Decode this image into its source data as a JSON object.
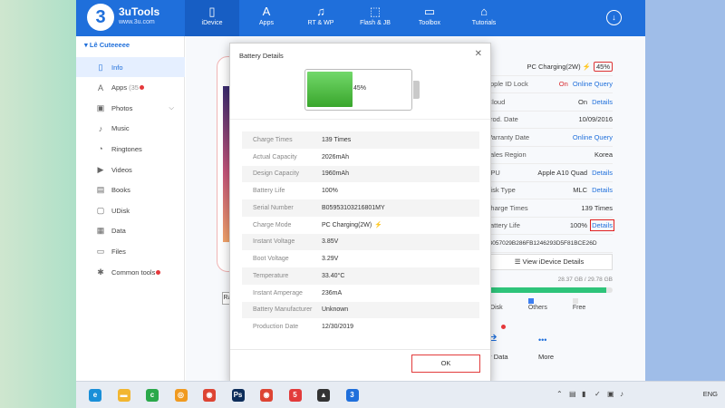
{
  "app": {
    "brand": "3uTools",
    "brand_logo": "3",
    "brand_url": "www.3u.com",
    "accent_color": "#1f6fdb",
    "nav": [
      {
        "label": "iDevice",
        "icon": "phone-icon",
        "glyph": "▯",
        "active": true
      },
      {
        "label": "Apps",
        "icon": "app-store-icon",
        "glyph": "A"
      },
      {
        "label": "RT & WP",
        "icon": "music-icon",
        "glyph": "♫"
      },
      {
        "label": "Flash & JB",
        "icon": "flash-icon",
        "glyph": "⬚"
      },
      {
        "label": "Toolbox",
        "icon": "toolbox-icon",
        "glyph": "▭"
      },
      {
        "label": "Tutorials",
        "icon": "graduation-cap-icon",
        "glyph": "⌂"
      }
    ],
    "download_glyph": "↓"
  },
  "sidebar": {
    "device_name": "Lê Cuteeeee",
    "chevron": "▾",
    "items": [
      {
        "label": "Info",
        "icon": "phone-icon",
        "glyph": "▯",
        "active": true
      },
      {
        "label": "Apps",
        "icon": "app-store-icon",
        "glyph": "A",
        "badge": "(35",
        "dot": true
      },
      {
        "label": "Photos",
        "icon": "photos-icon",
        "glyph": "▣",
        "chevron": "⌵"
      },
      {
        "label": "Music",
        "icon": "music-icon",
        "glyph": "♪"
      },
      {
        "label": "Ringtones",
        "icon": "bell-icon",
        "glyph": "◔"
      },
      {
        "label": "Videos",
        "icon": "video-icon",
        "glyph": "▶"
      },
      {
        "label": "Books",
        "icon": "book-icon",
        "glyph": "▤"
      },
      {
        "label": "UDisk",
        "icon": "usb-icon",
        "glyph": "▢"
      },
      {
        "label": "Data",
        "icon": "data-icon",
        "glyph": "▦"
      },
      {
        "label": "Files",
        "icon": "file-icon",
        "glyph": "▭"
      },
      {
        "label": "Common tools",
        "icon": "tools-icon",
        "glyph": "✱",
        "dot": true
      }
    ]
  },
  "device_info": {
    "charging": "PC Charging(2W)",
    "charging_pct": "45%",
    "bolt": "⚡",
    "rows": [
      {
        "label": "Apple ID Lock",
        "value": "On",
        "value_color": "#d8262b",
        "link": "Online Query"
      },
      {
        "label": "iCloud",
        "value": "On",
        "link": "Details"
      },
      {
        "label": "Prod. Date",
        "value": "10/09/2016"
      },
      {
        "label": "Warranty Date",
        "link": "Online Query"
      },
      {
        "label": "Sales Region",
        "value": "Korea"
      },
      {
        "label": "CPU",
        "value": "Apple A10 Quad",
        "link": "Details"
      },
      {
        "label": "Disk Type",
        "value": "MLC",
        "link": "Details"
      },
      {
        "label": "Charge Times",
        "value": "139 Times"
      },
      {
        "label": "Battery Life",
        "value": "100%",
        "link": "Details",
        "highlight": true
      }
    ],
    "udid": "73057029B286FB1246293D5F81BCE26D",
    "view_details": "View iDevice Details",
    "storage_text": "28.37 GB / 29.78 GB",
    "storage_used_fraction": 0.95,
    "legend": [
      {
        "label": "UDisk",
        "color": "#b486f0"
      },
      {
        "label": "Others",
        "color": "#3c7ef0"
      },
      {
        "label": "Free",
        "color": "#e4e4e4"
      }
    ],
    "ops": [
      {
        "label": "er Data",
        "icon": "transfer-data-icon",
        "glyph": "⇄",
        "dot": true
      },
      {
        "label": "More",
        "icon": "more-icon",
        "glyph": "•••"
      }
    ],
    "mini_button": "Ra"
  },
  "dialog": {
    "title": "Battery Details",
    "close": "✕",
    "battery_pct": "45%",
    "battery_level": 0.45,
    "details": [
      {
        "label": "Charge Times",
        "value": "139 Times"
      },
      {
        "label": "Actual Capacity",
        "value": "2026mAh"
      },
      {
        "label": "Design Capacity",
        "value": "1960mAh"
      },
      {
        "label": "Battery Life",
        "value": "100%"
      },
      {
        "label": "Serial Number",
        "value": "B05953103216801MY"
      },
      {
        "label": "Charge Mode",
        "value": "PC Charging(2W)",
        "bolt": true
      },
      {
        "label": "Instant Voltage",
        "value": "3.85V"
      },
      {
        "label": "Boot Voltage",
        "value": "3.29V"
      },
      {
        "label": "Temperature",
        "value": "33.40°C"
      },
      {
        "label": "Instant Amperage",
        "value": "236mA"
      },
      {
        "label": "Battery Manufacturer",
        "value": "Unknown"
      },
      {
        "label": "Production Date",
        "value": "12/30/2019"
      }
    ],
    "ok_label": "OK"
  },
  "taskbar": {
    "icons": [
      {
        "name": "edge-icon",
        "color": "#1a8fd8",
        "glyph": "e"
      },
      {
        "name": "file-explorer-icon",
        "color": "#f2b630",
        "glyph": "▬"
      },
      {
        "name": "coccoc-icon",
        "color": "#2aa84a",
        "glyph": "c"
      },
      {
        "name": "browser-icon",
        "color": "#f09a20",
        "glyph": "◎"
      },
      {
        "name": "chrome-icon",
        "color": "#dd4433",
        "glyph": "◉"
      },
      {
        "name": "photoshop-icon",
        "color": "#0d2d5a",
        "glyph": "Ps"
      },
      {
        "name": "chrome-profile-icon",
        "color": "#dd4433",
        "glyph": "◉"
      },
      {
        "name": "notification-app-icon",
        "color": "#e23b3b",
        "glyph": "5"
      },
      {
        "name": "photos-app-icon",
        "color": "#333333",
        "glyph": "▲"
      },
      {
        "name": "3utools-taskbar-icon",
        "color": "#1f6fdb",
        "glyph": "3"
      }
    ],
    "tray_icons": [
      "⌃",
      "▤",
      "▮",
      "✓",
      "▣",
      "♪"
    ],
    "language": "ENG"
  }
}
